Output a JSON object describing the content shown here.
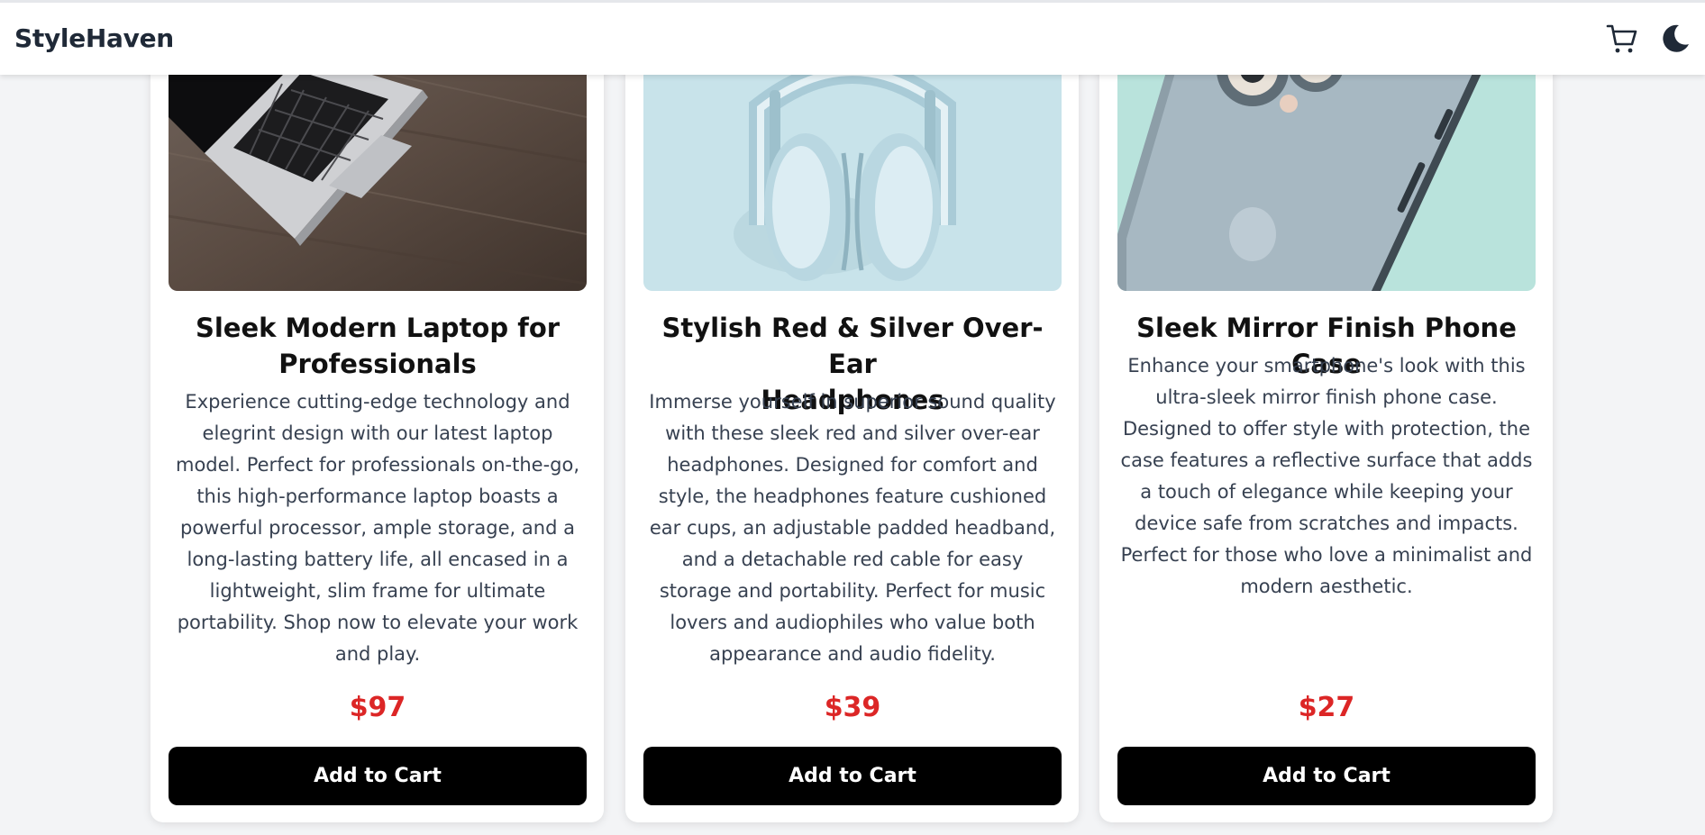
{
  "header": {
    "brand": "StyleHaven",
    "icons": [
      "cart-icon",
      "moon-icon"
    ]
  },
  "products": [
    {
      "title_lines": [
        "Sleek Modern Laptop for",
        "Professionals"
      ],
      "description": "Experience cutting-edge technology and elegrint design with our latest laptop model. Perfect for professionals on-the-go, this high-performance laptop boasts a powerful processor, ample storage, and a long-lasting battery life, all encased in a lightweight, slim frame for ultimate portability. Shop now to elevate your work and play.",
      "price": "$97",
      "button_label": "Add to Cart"
    },
    {
      "title_lines": [
        "Stylish Red & Silver Over-Ear",
        "Headphones"
      ],
      "description": "Immerse yourself in superior sound quality with these sleek red and silver over-ear headphones. Designed for comfort and style, the headphones feature cushioned ear cups, an adjustable padded headband, and a detachable red cable for easy storage and portability. Perfect for music lovers and audiophiles who value both appearance and audio fidelity.",
      "price": "$39",
      "button_label": "Add to Cart"
    },
    {
      "title_lines": [
        "Sleek Mirror Finish Phone Case"
      ],
      "description": "Enhance your smartphone's look with this ultra-sleek mirror finish phone case. Designed to offer style with protection, the case features a reflective surface that adds a touch of elegance while keeping your device safe from scratches and impacts. Perfect for those who love a minimalist and modern aesthetic.",
      "price": "$27",
      "button_label": "Add to Cart"
    }
  ],
  "colors": {
    "page_background": "#f3f4f6",
    "price": "#dc2626",
    "button": "#000000"
  }
}
